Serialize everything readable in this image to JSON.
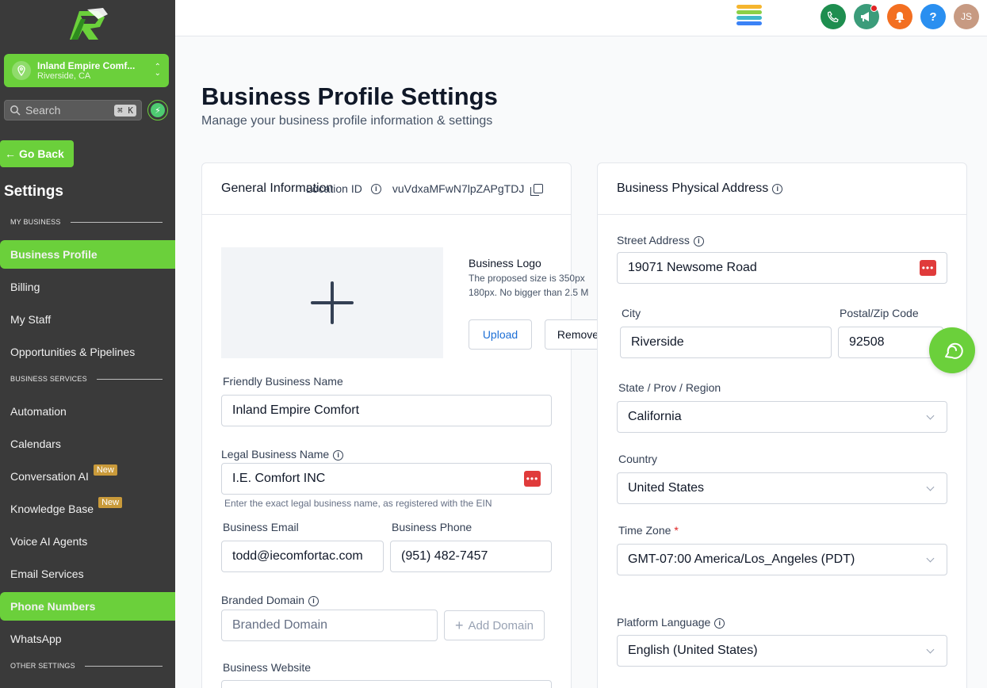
{
  "sidebar": {
    "location_name": "Inland Empire Comf...",
    "location_city": "Riverside, CA",
    "search_placeholder": "Search",
    "search_shortcut": "⌘ K",
    "go_back": "Go Back",
    "settings_title": "Settings",
    "sections": {
      "my_business": "MY BUSINESS",
      "business_services": "BUSINESS SERVICES",
      "other_settings": "OTHER SETTINGS"
    },
    "items": {
      "business_profile": "Business Profile",
      "billing": "Billing",
      "my_staff": "My Staff",
      "opportunities": "Opportunities & Pipelines",
      "automation": "Automation",
      "calendars": "Calendars",
      "conversation_ai": "Conversation AI",
      "knowledge_base": "Knowledge Base",
      "voice_ai": "Voice AI Agents",
      "email_services": "Email Services",
      "phone_numbers": "Phone Numbers",
      "whatsapp": "WhatsApp"
    },
    "new_badge": "New"
  },
  "topbar": {
    "help_label": "?",
    "avatar_initials": "JS"
  },
  "page": {
    "title": "Business Profile Settings",
    "subtitle": "Manage your business profile information & settings"
  },
  "general": {
    "heading": "General Information",
    "location_id_label": "Location ID",
    "location_id_value": "vuVdxaMFwN7lpZAPgTDJ",
    "logo_title": "Business Logo",
    "logo_hint_1": "The proposed size is 350px",
    "logo_hint_2": "180px. No bigger than 2.5 M",
    "upload": "Upload",
    "remove": "Remove",
    "friendly_name_label": "Friendly Business Name",
    "friendly_name_value": "Inland Empire Comfort",
    "legal_name_label": "Legal Business Name",
    "legal_name_value": "I.E. Comfort INC",
    "legal_name_hint": "Enter the exact legal business name, as registered with the EIN",
    "email_label": "Business Email",
    "email_value": "todd@iecomfortac.com",
    "phone_label": "Business Phone",
    "phone_value": "(951) 482-7457",
    "domain_label": "Branded Domain",
    "domain_placeholder": "Branded Domain",
    "add_domain": "Add Domain",
    "website_label": "Business Website"
  },
  "address": {
    "heading": "Business Physical Address",
    "street_label": "Street Address",
    "street_value": "19071 Newsome Road",
    "city_label": "City",
    "city_value": "Riverside",
    "zip_label": "Postal/Zip Code",
    "zip_value": "92508",
    "state_label": "State / Prov / Region",
    "state_value": "California",
    "country_label": "Country",
    "country_value": "United States",
    "timezone_label": "Time Zone",
    "timezone_required": "*",
    "timezone_value": "GMT-07:00 America/Los_Angeles (PDT)",
    "language_label": "Platform Language",
    "language_value": "English (United States)"
  },
  "colors": {
    "brand_green": "#6bd03b",
    "sidebar_bg": "#3a3a3a",
    "danger": "#e03b3b"
  }
}
